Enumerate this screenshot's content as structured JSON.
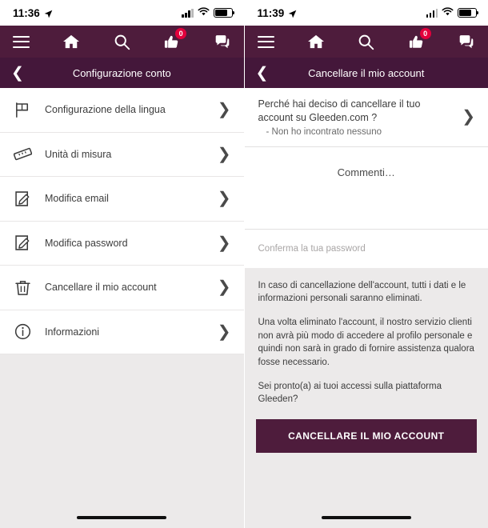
{
  "left": {
    "status": {
      "time": "11:36",
      "location_icon": "location-arrow-icon",
      "battery_icon": "battery-icon",
      "wifi_icon": "wifi-icon",
      "signal_icon": "cellular-signal-icon"
    },
    "nav": {
      "menu_icon": "hamburger-menu-icon",
      "home_icon": "home-icon",
      "search_icon": "search-icon",
      "likes_icon": "thumbs-up-icon",
      "likes_badge": "0",
      "chat_icon": "chat-bubble-icon"
    },
    "header": {
      "back_icon": "back-chevron-icon",
      "title": "Configurazione conto"
    },
    "items": [
      {
        "label": "Configurazione della lingua",
        "icon": "flag-icon",
        "name": "sidebar-item-language"
      },
      {
        "label": "Unità di misura",
        "icon": "ruler-icon",
        "name": "sidebar-item-units"
      },
      {
        "label": "Modifica email",
        "icon": "edit-email-icon",
        "name": "sidebar-item-edit-email"
      },
      {
        "label": "Modifica password",
        "icon": "edit-password-icon",
        "name": "sidebar-item-edit-password"
      },
      {
        "label": "Cancellare il mio account",
        "icon": "trash-icon",
        "name": "sidebar-item-delete-account"
      },
      {
        "label": "Informazioni",
        "icon": "info-icon",
        "name": "sidebar-item-info"
      }
    ]
  },
  "right": {
    "status": {
      "time": "11:39",
      "location_icon": "location-arrow-icon",
      "battery_icon": "battery-icon",
      "wifi_icon": "wifi-icon",
      "signal_icon": "cellular-signal-icon"
    },
    "nav": {
      "menu_icon": "hamburger-menu-icon",
      "home_icon": "home-icon",
      "search_icon": "search-icon",
      "likes_icon": "thumbs-up-icon",
      "likes_badge": "0",
      "chat_icon": "chat-bubble-icon"
    },
    "header": {
      "back_icon": "back-chevron-icon",
      "title": "Cancellare il mio account"
    },
    "reason": {
      "question": "Perché hai deciso di cancellare il tuo account su Gleeden.com ?",
      "answer": "- Non ho incontrato nessuno",
      "chevron_icon": "chevron-right-icon"
    },
    "comment_placeholder": "Commenti…",
    "password_placeholder": "Conferma la tua password",
    "info_paragraphs": [
      "In caso di cancellazione dell'account, tutti i dati e le informazioni personali saranno eliminati.",
      "Una volta eliminato l'account, il nostro servizio clienti non avrà più modo di accedere al profilo personale e quindi non sarà in grado di fornire assistenza qualora fosse necessario.",
      "Sei pronto(a) ai tuoi accessi sulla piattaforma Gleeden?"
    ],
    "delete_button": "CANCELLARE IL MIO ACCOUNT"
  },
  "colors": {
    "nav_purple": "#4e1c3c",
    "header_purple": "#44173a",
    "badge_red": "#e2003c",
    "page_gray": "#eceaea"
  }
}
